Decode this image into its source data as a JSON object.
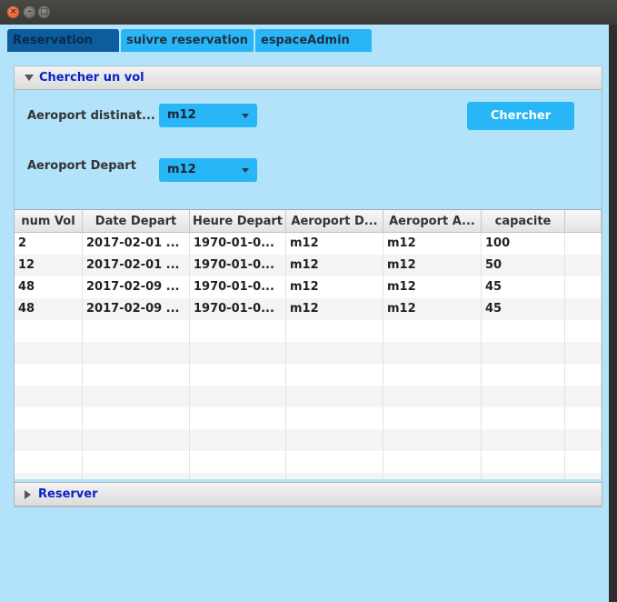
{
  "tabs": [
    {
      "label": "Reservation",
      "selected": true
    },
    {
      "label": "suivre reservation",
      "selected": false
    },
    {
      "label": "espaceAdmin",
      "selected": false
    }
  ],
  "search_pane": {
    "title": "Chercher un vol",
    "arrival_label": "Aeroport distinat...",
    "arrival_value": "m12",
    "departure_label": "Aeroport Depart",
    "departure_value": "m12",
    "search_button": "Chercher"
  },
  "table": {
    "columns": [
      "num Vol",
      "Date Depart",
      "Heure Depart",
      "Aeroport D...",
      "Aeroport A...",
      "capacite",
      ""
    ],
    "rows": [
      [
        "2",
        "2017-02-01 ...",
        "1970-01-0...",
        "m12",
        "m12",
        "100"
      ],
      [
        "12",
        "2017-02-01 ...",
        "1970-01-0...",
        "m12",
        "m12",
        "50"
      ],
      [
        "48",
        "2017-02-09 ...",
        "1970-01-0...",
        "m12",
        "m12",
        "45"
      ],
      [
        "48",
        "2017-02-09 ...",
        "1970-01-0...",
        "m12",
        "m12",
        "45"
      ]
    ]
  },
  "reserve_pane": {
    "title": "Reserver"
  },
  "colors": {
    "background": "#b3e3fa",
    "accent": "#29b6f6",
    "selected_tab": "#0d5c9e",
    "pane_title": "#0d22c6"
  }
}
